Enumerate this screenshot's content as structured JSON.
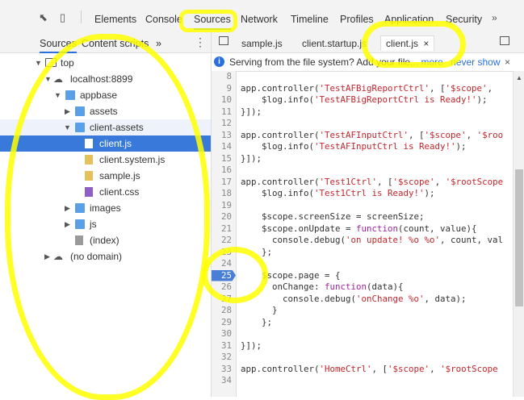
{
  "devtools_tabs": [
    "Elements",
    "Console",
    "Sources",
    "Network",
    "Timeline",
    "Profiles",
    "Application",
    "Security"
  ],
  "more_tabs": "»",
  "sidebar": {
    "tabs": [
      "Sources",
      "Content scripts"
    ],
    "more": "»",
    "menu": "⋮",
    "tree": [
      {
        "label": "top"
      },
      {
        "label": "localhost:8899"
      },
      {
        "label": "appbase"
      },
      {
        "label": "assets"
      },
      {
        "label": "client-assets"
      },
      {
        "label": "client.js"
      },
      {
        "label": "client.system.js"
      },
      {
        "label": "sample.js"
      },
      {
        "label": "client.css"
      },
      {
        "label": "images"
      },
      {
        "label": "js"
      },
      {
        "label": "(index)"
      },
      {
        "label": "(no domain)"
      }
    ]
  },
  "editor": {
    "tabs": [
      "sample.js",
      "client.startup.js",
      "client.js"
    ],
    "close": "×"
  },
  "infobar": {
    "icon": "i",
    "message": "Serving from the file system? Add your file...",
    "more": "more",
    "never": "never show",
    "close": "×"
  },
  "code": {
    "breakpoint_line": 25,
    "line_numbers": [
      8,
      9,
      10,
      11,
      12,
      13,
      14,
      15,
      16,
      17,
      18,
      19,
      20,
      21,
      22,
      23,
      24,
      25,
      26,
      27,
      28,
      29,
      30,
      31,
      32,
      33,
      34
    ],
    "lines": [
      "",
      "app.controller('TestAFBigReportCtrl', ['$scope',",
      "    $log.info('TestAFBigReportCtrl is Ready!');",
      "}]);",
      "",
      "app.controller('TestAFInputCtrl', ['$scope', '$roo",
      "    $log.info('TestAFInputCtrl is Ready!');",
      "}]);",
      "",
      "app.controller('Test1Ctrl', ['$scope', '$rootScope",
      "    $log.info('Test1Ctrl is Ready!');",
      "",
      "    $scope.screenSize = screenSize;",
      "    $scope.onUpdate = function(count, value){",
      "      console.debug('on update! %o %o', count, val",
      "    };",
      "",
      "    $scope.page = {",
      "      onChange: function(data){",
      "        console.debug('onChange %o', data);",
      "      }",
      "    };",
      "",
      "}]);",
      "",
      "app.controller('HomeCtrl', ['$scope', '$rootScope",
      ""
    ]
  }
}
